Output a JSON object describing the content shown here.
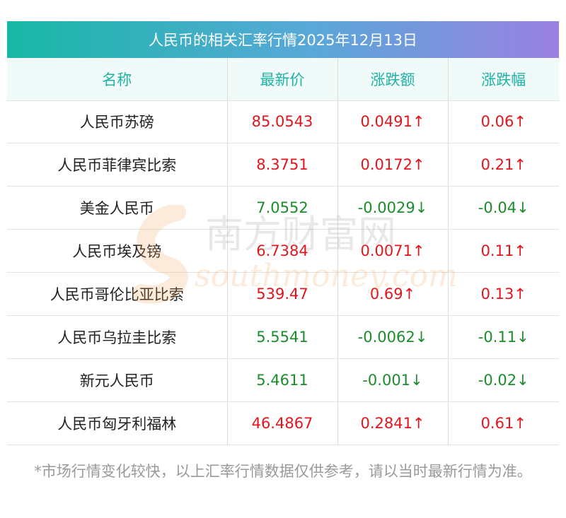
{
  "title": "人民币的相关汇率行情2025年12月13日",
  "columns": [
    "名称",
    "最新价",
    "涨跌额",
    "涨跌幅"
  ],
  "rows": [
    {
      "name": "人民币苏磅",
      "price": "85.0543",
      "change": "0.0491↑",
      "pct": "0.06↑",
      "dir": "up"
    },
    {
      "name": "人民币菲律宾比索",
      "price": "8.3751",
      "change": "0.0172↑",
      "pct": "0.21↑",
      "dir": "up"
    },
    {
      "name": "美金人民币",
      "price": "7.0552",
      "change": "-0.0029↓",
      "pct": "-0.04↓",
      "dir": "down"
    },
    {
      "name": "人民币埃及镑",
      "price": "6.7384",
      "change": "0.0071↑",
      "pct": "0.11↑",
      "dir": "up"
    },
    {
      "name": "人民币哥伦比亚比索",
      "price": "539.47",
      "change": "0.69↑",
      "pct": "0.13↑",
      "dir": "up"
    },
    {
      "name": "人民币乌拉圭比索",
      "price": "5.5541",
      "change": "-0.0062↓",
      "pct": "-0.11↓",
      "dir": "down"
    },
    {
      "name": "新元人民币",
      "price": "5.4611",
      "change": "-0.001↓",
      "pct": "-0.02↓",
      "dir": "down"
    },
    {
      "name": "人民币匈牙利福林",
      "price": "46.4867",
      "change": "0.2841↑",
      "pct": "0.61↑",
      "dir": "up"
    }
  ],
  "watermark": {
    "cn": "南方财富网",
    "en": "southmoney.com"
  },
  "note": "*市场行情变化较快，以上汇率行情数据仅供参考，请以当时最新行情为准。",
  "colors": {
    "up": "#e4141c",
    "down": "#1a8d2a",
    "header_text": "#20b2a4"
  }
}
